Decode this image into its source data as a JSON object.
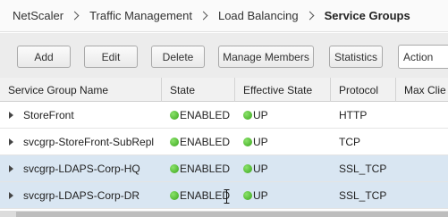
{
  "breadcrumb": {
    "items": [
      "NetScaler",
      "Traffic Management",
      "Load Balancing"
    ],
    "current": "Service Groups"
  },
  "toolbar": {
    "add_label": "Add",
    "edit_label": "Edit",
    "delete_label": "Delete",
    "manage_members_label": "Manage Members",
    "statistics_label": "Statistics",
    "action_label": "Action"
  },
  "table": {
    "columns": [
      "Service Group Name",
      "State",
      "Effective State",
      "Protocol",
      "Max Clie"
    ],
    "rows": [
      {
        "name": "StoreFront",
        "state": "ENABLED",
        "effective_state": "UP",
        "protocol": "HTTP",
        "selected": false
      },
      {
        "name": "svcgrp-StoreFront-SubRepl",
        "state": "ENABLED",
        "effective_state": "UP",
        "protocol": "TCP",
        "selected": false
      },
      {
        "name": "svcgrp-LDAPS-Corp-HQ",
        "state": "ENABLED",
        "effective_state": "UP",
        "protocol": "SSL_TCP",
        "selected": true
      },
      {
        "name": "svcgrp-LDAPS-Corp-DR",
        "state": "ENABLED",
        "effective_state": "UP",
        "protocol": "SSL_TCP",
        "selected": true
      }
    ]
  },
  "colors": {
    "status_green": "#3aa51c",
    "selected_row": "#d9e6f2"
  },
  "icons": {
    "expander": "triangle-right-icon",
    "status": "green-dot-icon",
    "breadcrumb_separator": "chevron-right-icon"
  }
}
